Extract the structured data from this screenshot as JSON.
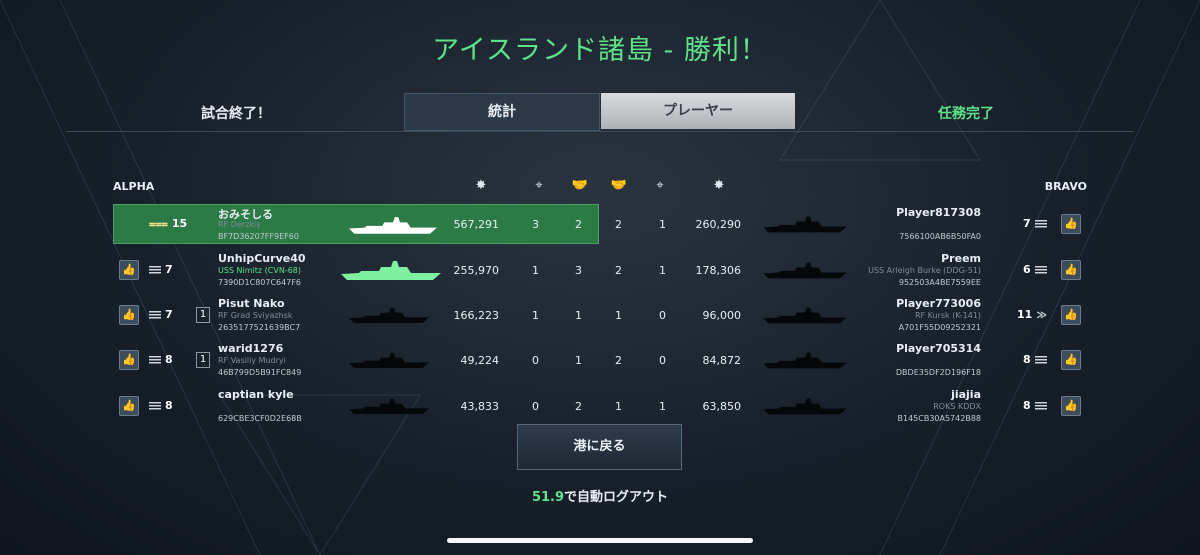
{
  "title": "アイスランド諸島 - 勝利！",
  "match_status": "試合終了！",
  "mission_status": "任務完了",
  "tabs": {
    "stats": "統計",
    "players": "プレーヤー"
  },
  "teams": {
    "alpha": "ALPHA",
    "bravo": "BRAVO"
  },
  "column_icons": [
    "explosion-icon",
    "crosshair-icon",
    "handshake-icon",
    "handshake-icon",
    "crosshair-icon",
    "explosion-icon"
  ],
  "alpha": [
    {
      "rank_value": "15",
      "rank_icon": "medal-icon",
      "level": "",
      "name": "おみそしる",
      "ship": "RF Derzkiy",
      "ship_green": false,
      "id": "BF7D36207FF9EF60",
      "damage": "567,291",
      "kills": "3",
      "assists": "2",
      "me": true
    },
    {
      "rank_value": "7",
      "rank_icon": "bars-icon",
      "level": "",
      "name": "UnhipCurve40",
      "ship": "USS Nimitz (CVN-68)",
      "ship_green": true,
      "id": "7390D1C807C647F6",
      "damage": "255,970",
      "kills": "1",
      "assists": "3",
      "me": false
    },
    {
      "rank_value": "7",
      "rank_icon": "bars-icon",
      "level": "1",
      "name": "Pisut Nako",
      "ship": "RF Grad Sviyazhsk",
      "ship_green": false,
      "id": "2635177521639BC7",
      "damage": "166,223",
      "kills": "1",
      "assists": "1",
      "me": false
    },
    {
      "rank_value": "8",
      "rank_icon": "bars-icon",
      "level": "1",
      "name": "warid1276",
      "ship": "RF Vasiliy Mudryi",
      "ship_green": false,
      "id": "46B799D5B91FC849",
      "damage": "49,224",
      "kills": "0",
      "assists": "1",
      "me": false
    },
    {
      "rank_value": "8",
      "rank_icon": "bars-icon",
      "level": "",
      "name": "captian kyle",
      "ship": "",
      "ship_green": false,
      "id": "629CBE3CF0D2E68B",
      "damage": "43,833",
      "kills": "0",
      "assists": "2",
      "me": false
    }
  ],
  "bravo": [
    {
      "rank_value": "7",
      "name": "Player817308",
      "ship": "",
      "id": "7566100AB6B50FA0",
      "assists": "2",
      "kills": "1",
      "damage": "260,290"
    },
    {
      "rank_value": "6",
      "name": "Preem",
      "ship": "USS Arleigh Burke (DDG-51)",
      "id": "952503A4BE7559EE",
      "assists": "2",
      "kills": "1",
      "damage": "178,306"
    },
    {
      "rank_value": "11",
      "name": "Player773006",
      "ship": "RF Kursk (K-141)",
      "id": "A701F55D09252321",
      "assists": "1",
      "kills": "0",
      "damage": "96,000"
    },
    {
      "rank_value": "8",
      "name": "Player705314",
      "ship": "",
      "id": "DBDE35DF2D196F18",
      "assists": "2",
      "kills": "0",
      "damage": "84,872"
    },
    {
      "rank_value": "8",
      "name": "jiajia",
      "ship": "ROKS KDDX",
      "id": "B145CB30A5742B88",
      "assists": "1",
      "kills": "1",
      "damage": "63,850"
    }
  ],
  "return_button": "港に戻る",
  "logout_seconds": "51.9",
  "logout_text": "で自動ログアウト",
  "colors": {
    "accent_green": "#5ee28a",
    "highlight_row": "#2c7a45"
  }
}
